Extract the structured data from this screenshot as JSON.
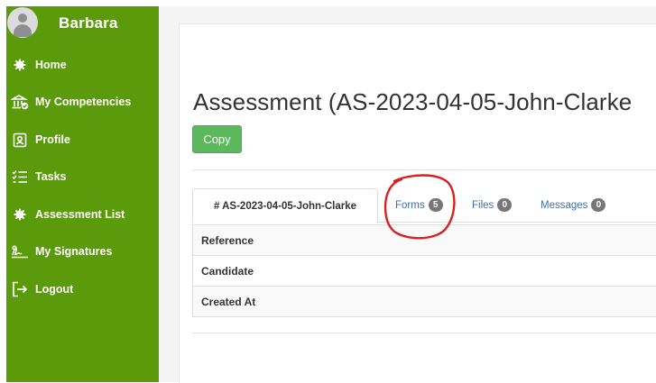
{
  "user": {
    "name": "Barbara"
  },
  "sidebar": {
    "items": [
      {
        "label": "Home",
        "icon": "gear-icon"
      },
      {
        "label": "My Competencies",
        "icon": "institution-check-icon"
      },
      {
        "label": "Profile",
        "icon": "id-badge-icon"
      },
      {
        "label": "Tasks",
        "icon": "task-list-icon"
      },
      {
        "label": "Assessment List",
        "icon": "gear-icon",
        "active": true
      },
      {
        "label": "My Signatures",
        "icon": "signature-icon"
      },
      {
        "label": "Logout",
        "icon": "logout-icon"
      }
    ]
  },
  "main": {
    "title": "Assessment (AS-2023-04-05-John-Clarke",
    "copy_label": "Copy",
    "tabs": [
      {
        "label": "# AS-2023-04-05-John-Clarke",
        "active": true
      },
      {
        "label": "Forms",
        "count": "5"
      },
      {
        "label": "Files",
        "count": "0"
      },
      {
        "label": "Messages",
        "count": "0"
      }
    ],
    "table_rows": [
      "Reference",
      "Candidate",
      "Created At"
    ]
  },
  "colors": {
    "sidebar_bg": "#5b9a0a",
    "copy_button": "#5cb85c",
    "tab_link": "#3a6fb0",
    "badge": "#777777",
    "annotation": "#d92020"
  }
}
